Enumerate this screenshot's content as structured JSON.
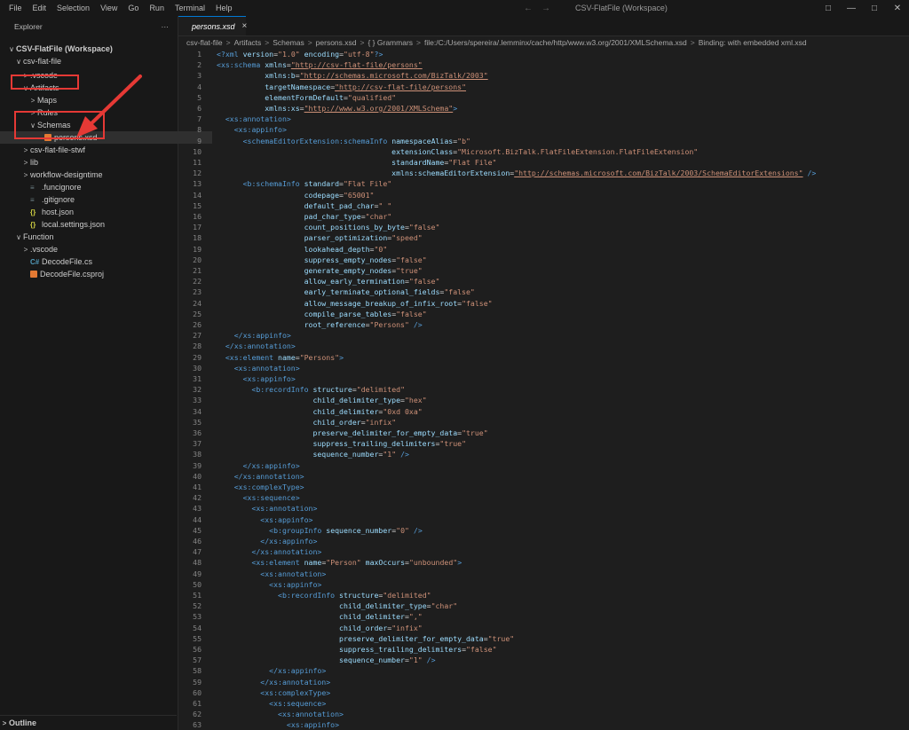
{
  "menu": [
    "File",
    "Edit",
    "Selection",
    "View",
    "Go",
    "Run",
    "Terminal",
    "Help"
  ],
  "window_title": "CSV-FlatFile (Workspace)",
  "explorer": {
    "title": "Explorer",
    "more": "···",
    "items": [
      {
        "label": "CSV-FlatFile (Workspace)",
        "indent": 0,
        "twisty": "∨",
        "icon": "",
        "bold": true
      },
      {
        "label": "csv-flat-file",
        "indent": 1,
        "twisty": "∨",
        "icon": ""
      },
      {
        "label": ".vscode",
        "indent": 2,
        "twisty": ">",
        "icon": ""
      },
      {
        "label": "Artifacts",
        "indent": 2,
        "twisty": "∨",
        "icon": ""
      },
      {
        "label": "Maps",
        "indent": 3,
        "twisty": ">",
        "icon": ""
      },
      {
        "label": "Rules",
        "indent": 3,
        "twisty": ">",
        "icon": ""
      },
      {
        "label": "Schemas",
        "indent": 3,
        "twisty": "∨",
        "icon": ""
      },
      {
        "label": "persons.xsd",
        "indent": 4,
        "twisty": "",
        "icon": "rss",
        "selected": true
      },
      {
        "label": "csv-flat-file-stwf",
        "indent": 2,
        "twisty": ">",
        "icon": ""
      },
      {
        "label": "lib",
        "indent": 2,
        "twisty": ">",
        "icon": ""
      },
      {
        "label": "workflow-designtime",
        "indent": 2,
        "twisty": ">",
        "icon": ""
      },
      {
        "label": ".funcignore",
        "indent": 2,
        "twisty": "",
        "icon": "dot"
      },
      {
        "label": ".gitignore",
        "indent": 2,
        "twisty": "",
        "icon": "dot"
      },
      {
        "label": "host.json",
        "indent": 2,
        "twisty": "",
        "icon": "json"
      },
      {
        "label": "local.settings.json",
        "indent": 2,
        "twisty": "",
        "icon": "json"
      },
      {
        "label": "Function",
        "indent": 1,
        "twisty": "∨",
        "icon": ""
      },
      {
        "label": ".vscode",
        "indent": 2,
        "twisty": ">",
        "icon": ""
      },
      {
        "label": "DecodeFile.cs",
        "indent": 2,
        "twisty": "",
        "icon": "cs"
      },
      {
        "label": "DecodeFile.csproj",
        "indent": 2,
        "twisty": "",
        "icon": "rss"
      }
    ],
    "outline": "Outline"
  },
  "tab": {
    "label": "persons.xsd",
    "close": "×"
  },
  "breadcrumb": [
    "csv-flat-file",
    "Artifacts",
    "Schemas",
    "persons.xsd",
    "{ } Grammars",
    "file:/C:/Users/spereira/.lemminx/cache/http/www.w3.org/2001/XMLSchema.xsd",
    "Binding: with embedded xml.xsd"
  ],
  "code_lines": [
    "<?xml version=\"1.0\" encoding=\"utf-8\"?>",
    "<xs:schema xmlns=\"http://csv-flat-file/persons\"",
    "           xmlns:b=\"http://schemas.microsoft.com/BizTalk/2003\"",
    "           targetNamespace=\"http://csv-flat-file/persons\"",
    "           elementFormDefault=\"qualified\"",
    "           xmlns:xs=\"http://www.w3.org/2001/XMLSchema\">",
    "  <xs:annotation>",
    "    <xs:appinfo>",
    "      <schemaEditorExtension:schemaInfo namespaceAlias=\"b\"",
    "                                        extensionClass=\"Microsoft.BizTalk.FlatFileExtension.FlatFileExtension\"",
    "                                        standardName=\"Flat File\"",
    "                                        xmlns:schemaEditorExtension=\"http://schemas.microsoft.com/BizTalk/2003/SchemaEditorExtensions\" />",
    "      <b:schemaInfo standard=\"Flat File\"",
    "                    codepage=\"65001\"",
    "                    default_pad_char=\" \"",
    "                    pad_char_type=\"char\"",
    "                    count_positions_by_byte=\"false\"",
    "                    parser_optimization=\"speed\"",
    "                    lookahead_depth=\"0\"",
    "                    suppress_empty_nodes=\"false\"",
    "                    generate_empty_nodes=\"true\"",
    "                    allow_early_termination=\"false\"",
    "                    early_terminate_optional_fields=\"false\"",
    "                    allow_message_breakup_of_infix_root=\"false\"",
    "                    compile_parse_tables=\"false\"",
    "                    root_reference=\"Persons\" />",
    "    </xs:appinfo>",
    "  </xs:annotation>",
    "  <xs:element name=\"Persons\">",
    "    <xs:annotation>",
    "      <xs:appinfo>",
    "        <b:recordInfo structure=\"delimited\"",
    "                      child_delimiter_type=\"hex\"",
    "                      child_delimiter=\"0xd 0xa\"",
    "                      child_order=\"infix\"",
    "                      preserve_delimiter_for_empty_data=\"true\"",
    "                      suppress_trailing_delimiters=\"true\"",
    "                      sequence_number=\"1\" />",
    "      </xs:appinfo>",
    "    </xs:annotation>",
    "    <xs:complexType>",
    "      <xs:sequence>",
    "        <xs:annotation>",
    "          <xs:appinfo>",
    "            <b:groupInfo sequence_number=\"0\" />",
    "          </xs:appinfo>",
    "        </xs:annotation>",
    "        <xs:element name=\"Person\" maxOccurs=\"unbounded\">",
    "          <xs:annotation>",
    "            <xs:appinfo>",
    "              <b:recordInfo structure=\"delimited\"",
    "                            child_delimiter_type=\"char\"",
    "                            child_delimiter=\",\"",
    "                            child_order=\"infix\"",
    "                            preserve_delimiter_for_empty_data=\"true\"",
    "                            suppress_trailing_delimiters=\"false\"",
    "                            sequence_number=\"1\" />",
    "            </xs:appinfo>",
    "          </xs:annotation>",
    "          <xs:complexType>",
    "            <xs:sequence>",
    "              <xs:annotation>",
    "                <xs:appinfo>"
  ],
  "first_line_number": 1,
  "colors": {
    "accent": "#0078d4",
    "highlight": "#e53935",
    "tag": "#569cd6",
    "attr": "#9cdcfe",
    "value": "#ce9178"
  }
}
